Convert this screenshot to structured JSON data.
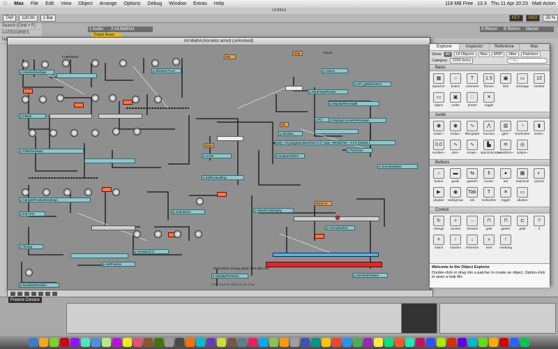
{
  "menubar": {
    "apple": "",
    "app_name": "Max",
    "items": [
      "File",
      "Edit",
      "View",
      "Object",
      "Arrange",
      "Options",
      "Debug",
      "Window",
      "Extras",
      "Help"
    ],
    "memory": "118 MB Free",
    "battery": "13.3",
    "clock": "Thu 11 Apr 20:23",
    "user": "Matt Acton"
  },
  "live": {
    "window_title": "Untitled",
    "tap_label": "TAP",
    "tempo": "120.00",
    "bar_pos": "1 Bar",
    "key_label": "KEY",
    "midi_label": "MIDI",
    "cpu": "25 %",
    "track1": "1 Audio",
    "track2": "2 ml.MattAct",
    "clip_label": "Thatch Room",
    "return_a": "A Return",
    "return_b": "B Return",
    "master": "Master",
    "browser_search": "Search (Cmd + F)",
    "browser_header": "CATEGORIES",
    "browser_name": "Name",
    "freeze_tooltip": "Freeze Device"
  },
  "patcher": {
    "title": "ml.MattActionator.amxd (unlocked)",
    "objects": {
      "volume_env": "p VolumeEnvelope",
      "cutrelease": "CutRelease",
      "window": "p Window+Fuzz",
      "am": "AM",
      "help": "Help",
      "voices": "Voices",
      "voices_obj": "p Voices",
      "api": "p API_getDeviceOn",
      "param_router": "p ParameterRouter",
      "display_len": "p DisplayFileLength",
      "display_pos": "p DisplayCurrentFilePosition",
      "fback": "p FBack",
      "lfo": "LFO",
      "pwindow": "p Window",
      "poly": "poly~ ml.polygranulator0010-3-27 args ~WINDOW~ ~LFO @steal 1",
      "output_vol": "p OutputVolume",
      "gran_wave": "p GranularWave",
      "pos_grain": "p PosGrain",
      "filter_env": "p FilterEnvelope",
      "sample_pos": "p SamplePositionEnvelope",
      "fm_lfo": "p FM-LFO",
      "grain_drive": "p GrainDrive",
      "buffer_handling": "p BufferHandling",
      "waveform": "p WaveformDisplay",
      "zoom_in": "Zoom In",
      "timing": "p Timing",
      "position_lfo": "p PositionLFO",
      "fancy": "p FancyDialChi",
      "set_position": "p SetPosition",
      "user_set_pos": "p UserSetPosition",
      "read_out": "p ReadOutPosition",
      "click_note": "click before closing patch: sets data info",
      "display_file": "p DisplayFileName",
      "copyright": "2013 Soundz Mould & 25 Lines",
      "limits": "p Limits",
      "dairy": "Dairy",
      "fb": "FB"
    }
  },
  "explorer": {
    "tabs": [
      "Explorer",
      "Inspector",
      "Reference",
      "Max"
    ],
    "show_label": "Show",
    "filters": [
      "All",
      "UI Objects",
      "Max",
      "MSP",
      "Jitter",
      "Patchers"
    ],
    "category_label": "Category",
    "item_count": "1009 items",
    "filter_placeholder": "Filter",
    "sections": [
      {
        "name": "Basic",
        "items": [
          {
            "label": "bpatcher",
            "icon": "bpatcher-icon",
            "glyph": "▦"
          },
          {
            "label": "button",
            "icon": "button-icon",
            "glyph": "○"
          },
          {
            "label": "comment",
            "icon": "comment-icon",
            "glyph": "T"
          },
          {
            "label": "flonum",
            "icon": "flonum-icon",
            "glyph": "1.5"
          },
          {
            "label": "inlet",
            "icon": "inlet-icon",
            "glyph": "▣"
          },
          {
            "label": "message",
            "icon": "message-icon",
            "glyph": "▭"
          },
          {
            "label": "number",
            "icon": "number-icon",
            "glyph": "12"
          },
          {
            "label": "object",
            "icon": "object-icon",
            "glyph": "▭"
          },
          {
            "label": "outlet",
            "icon": "outlet-icon",
            "glyph": "▣"
          },
          {
            "label": "preset",
            "icon": "preset-icon",
            "glyph": "∷"
          },
          {
            "label": "toggle",
            "icon": "toggle-icon",
            "glyph": "✕"
          }
        ]
      },
      {
        "name": "Audio",
        "items": [
          {
            "label": "ezadc~",
            "icon": "mic-icon",
            "glyph": "◉"
          },
          {
            "label": "ezdac~",
            "icon": "speaker-icon",
            "glyph": "◉"
          },
          {
            "label": "filtergraph",
            "icon": "filtergraph-icon",
            "glyph": "∿"
          },
          {
            "label": "function",
            "icon": "function-icon",
            "glyph": "⋀"
          },
          {
            "label": "gain~",
            "icon": "gain-icon",
            "glyph": "▥"
          },
          {
            "label": "levelmeter",
            "icon": "levelmeter-icon",
            "glyph": "◔"
          },
          {
            "label": "meter~",
            "icon": "meter-icon",
            "glyph": "▮"
          },
          {
            "label": "number~",
            "icon": "number-tilde-icon",
            "glyph": "0.0"
          },
          {
            "label": "plot~",
            "icon": "plot-icon",
            "glyph": "∿"
          },
          {
            "label": "scope~",
            "icon": "scope-icon",
            "glyph": "∿"
          },
          {
            "label": "spectroscope~",
            "icon": "spectroscope-icon",
            "glyph": "▙"
          },
          {
            "label": "waveform~",
            "icon": "waveform-icon",
            "glyph": "≋"
          },
          {
            "label": "zplane~",
            "icon": "zplane-icon",
            "glyph": "◎"
          }
        ]
      },
      {
        "name": "Buttons",
        "items": [
          {
            "label": "button",
            "icon": "button-icon",
            "glyph": "○"
          },
          {
            "label": "guide",
            "icon": "guide-icon",
            "glyph": "▬"
          },
          {
            "label": "gswitch",
            "icon": "gswitch-icon",
            "glyph": "⇆"
          },
          {
            "label": "incdec",
            "icon": "incdec-icon",
            "glyph": "⇕"
          },
          {
            "label": "led",
            "icon": "led-icon",
            "glyph": "●"
          },
          {
            "label": "matrixctrl",
            "icon": "matrixctrl-icon",
            "glyph": "▦"
          },
          {
            "label": "pictctrl",
            "icon": "pictctrl-icon",
            "glyph": "◐"
          },
          {
            "label": "playbar",
            "icon": "playbar-icon",
            "glyph": "▶"
          },
          {
            "label": "radiogroup",
            "icon": "radiogroup-icon",
            "glyph": "◉"
          },
          {
            "label": "tab",
            "icon": "tab-icon",
            "glyph": "Tab"
          },
          {
            "label": "textbutton",
            "icon": "textbutton-icon",
            "glyph": "T"
          },
          {
            "label": "toggle",
            "icon": "toggle-icon",
            "glyph": "✕"
          },
          {
            "label": "ubutton",
            "icon": "ubutton-icon",
            "glyph": "▭"
          }
        ]
      },
      {
        "name": "Control",
        "items": [
          {
            "label": "change",
            "icon": "change-icon",
            "glyph": "↻"
          },
          {
            "label": "counter",
            "icon": "counter-icon",
            "glyph": "+"
          },
          {
            "label": "forward",
            "icon": "forward-icon",
            "glyph": "→"
          },
          {
            "label": "gate",
            "icon": "gate-icon",
            "glyph": "⊓"
          },
          {
            "label": "gatetrr",
            "icon": "gatetrr-icon",
            "glyph": "⊓"
          },
          {
            "label": "grab",
            "icon": "grab-icon",
            "glyph": "⊏"
          },
          {
            "label": "if",
            "icon": "if-icon",
            "glyph": "?"
          },
          {
            "label": "match",
            "icon": "match-icon",
            "glyph": "="
          },
          {
            "label": "maximu",
            "icon": "maximum-icon",
            "glyph": "↑"
          },
          {
            "label": "minimum",
            "icon": "minimum-icon",
            "glyph": "↓"
          },
          {
            "label": "next",
            "icon": "next-icon",
            "glyph": "»"
          },
          {
            "label": "onebang",
            "icon": "onebang-icon",
            "glyph": "!"
          }
        ]
      }
    ],
    "desc_title": "Welcome to the Object Explorer",
    "desc_body": "Double-click or drag into a patcher to create an object. Option-click to open a help file."
  },
  "colors": {
    "patch_bg": "#8f8f8f",
    "teal": "#8fc6cc",
    "orange": "#f0a040",
    "red_bar": "#e02a2a",
    "blue_bar": "#4fb6e0"
  }
}
